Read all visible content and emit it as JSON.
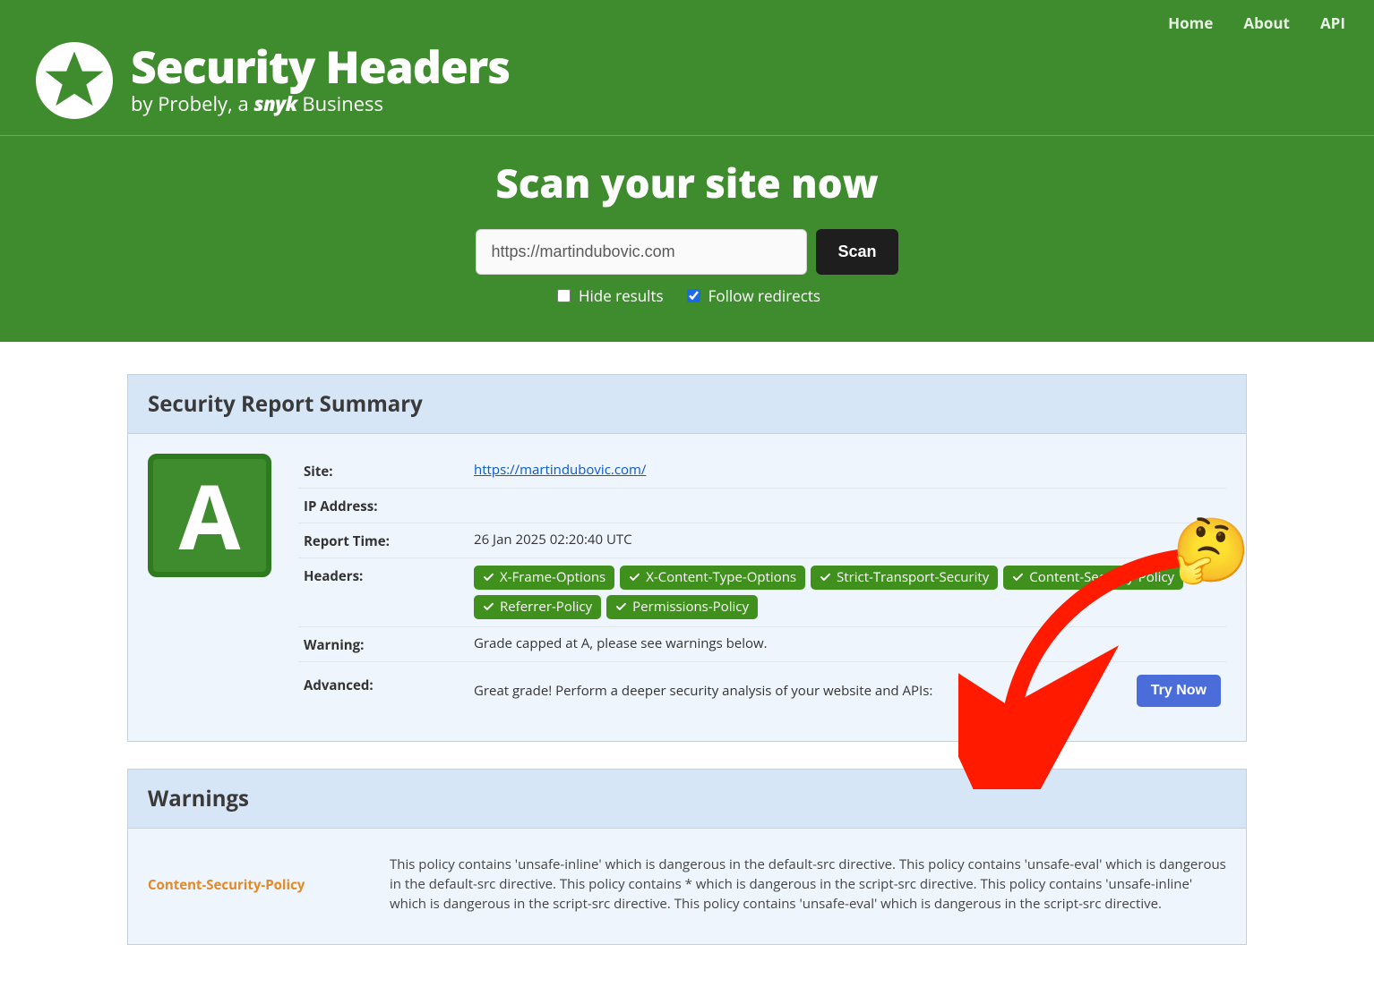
{
  "nav": {
    "home": "Home",
    "about": "About",
    "api": "API"
  },
  "brand": {
    "title": "Security Headers",
    "tag_pre": "by Probely, a ",
    "tag_bold": "snyk",
    "tag_post": " Business"
  },
  "scan": {
    "title": "Scan your site now",
    "value": "https://martindubovic.com",
    "button": "Scan",
    "hide_label": "Hide results",
    "hide_checked": false,
    "follow_label": "Follow redirects",
    "follow_checked": true
  },
  "summary": {
    "title": "Security Report Summary",
    "grade": "A",
    "rows": {
      "site_k": "Site:",
      "site_v": "https://martindubovic.com/",
      "ip_k": "IP Address:",
      "ip_v": "",
      "time_k": "Report Time:",
      "time_v": "26 Jan 2025 02:20:40 UTC",
      "headers_k": "Headers:",
      "warning_k": "Warning:",
      "warning_v": "Grade capped at A, please see warnings below.",
      "advanced_k": "Advanced:",
      "advanced_v": "Great grade! Perform a deeper security analysis of your website and APIs:",
      "try_now": "Try Now"
    },
    "headers": [
      "X-Frame-Options",
      "X-Content-Type-Options",
      "Strict-Transport-Security",
      "Content-Security-Policy",
      "Referrer-Policy",
      "Permissions-Policy"
    ]
  },
  "warnings": {
    "title": "Warnings",
    "items": [
      {
        "name": "Content-Security-Policy",
        "text": "This policy contains 'unsafe-inline' which is dangerous in the default-src directive. This policy contains 'unsafe-eval' which is dangerous in the default-src directive. This policy contains * which is dangerous in the script-src directive. This policy contains 'unsafe-inline' which is dangerous in the script-src directive. This policy contains 'unsafe-eval' which is dangerous in the script-src directive."
      }
    ]
  },
  "emoji": "🤔"
}
